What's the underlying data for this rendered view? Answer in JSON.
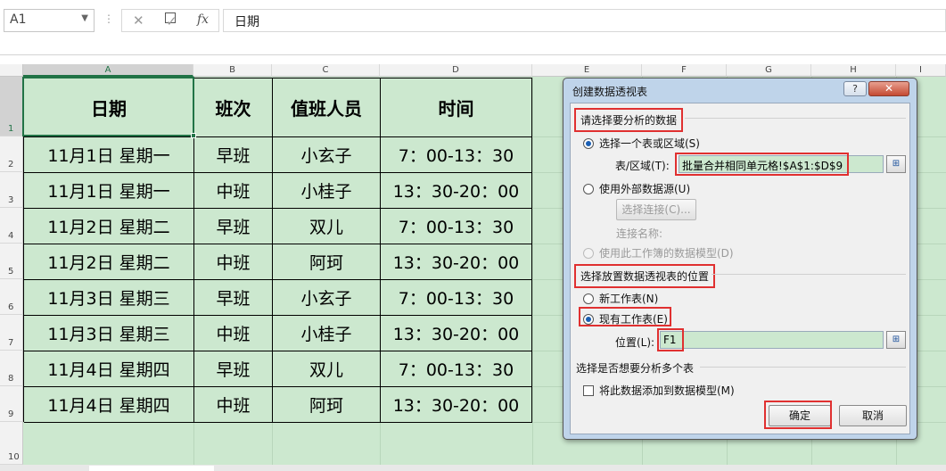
{
  "formula_bar": {
    "name_box": "A1",
    "cancel_glyph": "✕",
    "confirm_glyph": "✓",
    "fx_glyph": "fx",
    "content": "日期"
  },
  "columns": [
    "A",
    "B",
    "C",
    "D",
    "E",
    "F",
    "G",
    "H",
    "I"
  ],
  "rows": [
    "1",
    "2",
    "3",
    "4",
    "5",
    "6",
    "7",
    "8",
    "9",
    "10"
  ],
  "table": {
    "headers": [
      "日期",
      "班次",
      "值班人员",
      "时间"
    ],
    "rows": [
      [
        "11月1日 星期一",
        "早班",
        "小玄子",
        "7：00-13：30"
      ],
      [
        "11月1日 星期一",
        "中班",
        "小桂子",
        "13：30-20：00"
      ],
      [
        "11月2日 星期二",
        "早班",
        "双儿",
        "7：00-13：30"
      ],
      [
        "11月2日 星期二",
        "中班",
        "阿珂",
        "13：30-20：00"
      ],
      [
        "11月3日 星期三",
        "早班",
        "小玄子",
        "7：00-13：30"
      ],
      [
        "11月3日 星期三",
        "中班",
        "小桂子",
        "13：30-20：00"
      ],
      [
        "11月4日 星期四",
        "早班",
        "双儿",
        "7：00-13：30"
      ],
      [
        "11月4日 星期四",
        "中班",
        "阿珂",
        "13：30-20：00"
      ]
    ]
  },
  "dialog": {
    "title": "创建数据透视表",
    "help_label": "?",
    "close_label": "✕",
    "section1": "请选择要分析的数据",
    "opt_select_range": "选择一个表或区域(S)",
    "range_label": "表/区域(T):",
    "range_value": "批量合并相同单元格!$A$1:$D$9",
    "opt_external": "使用外部数据源(U)",
    "choose_connection": "选择连接(C)...",
    "connection_name": "连接名称:",
    "opt_data_model": "使用此工作簿的数据模型(D)",
    "section2": "选择放置数据透视表的位置",
    "opt_new_sheet": "新工作表(N)",
    "opt_existing_sheet": "现有工作表(E)",
    "location_label": "位置(L):",
    "location_value": "F1",
    "section3": "选择是否想要分析多个表",
    "add_to_model": "将此数据添加到数据模型(M)",
    "ok": "确定",
    "cancel": "取消",
    "picker_glyph": "⊞"
  }
}
